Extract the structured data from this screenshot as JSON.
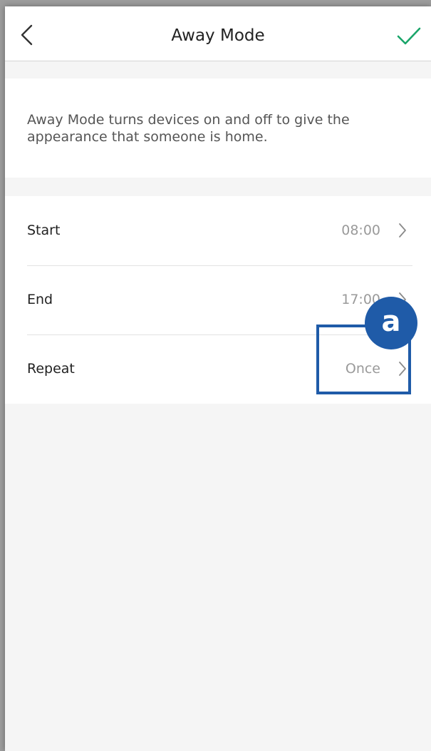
{
  "header": {
    "title": "Away Mode",
    "back_icon": "chevron-left-icon",
    "confirm_icon": "checkmark-icon",
    "confirm_color": "#1aa56a"
  },
  "info": {
    "description": "Away Mode turns devices on and off to give the appearance that someone is home."
  },
  "settings": {
    "rows": [
      {
        "label": "Start",
        "value": "08:00"
      },
      {
        "label": "End",
        "value": "17:00"
      },
      {
        "label": "Repeat",
        "value": "Once"
      }
    ]
  },
  "annotation": {
    "badge_label": "a",
    "color": "#1f5ba8"
  }
}
